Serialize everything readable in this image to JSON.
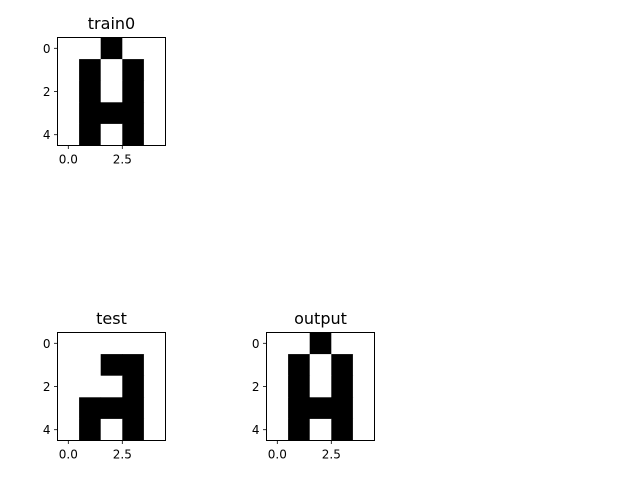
{
  "chart_data": [
    {
      "type": "heatmap",
      "title": "train0",
      "grid": [
        [
          0,
          0,
          1,
          0,
          0
        ],
        [
          0,
          1,
          0,
          1,
          0
        ],
        [
          0,
          1,
          0,
          1,
          0
        ],
        [
          0,
          1,
          1,
          1,
          0
        ],
        [
          0,
          1,
          0,
          1,
          0
        ]
      ],
      "xticks": [
        0.0,
        2.5
      ],
      "xtick_labels": [
        "0.0",
        "2.5"
      ],
      "yticks": [
        0,
        2,
        4
      ],
      "ytick_labels": [
        "0",
        "2",
        "4"
      ],
      "colors": {
        "0": "#ffffff",
        "1": "#000000"
      }
    },
    {
      "type": "heatmap",
      "title": "test",
      "grid": [
        [
          0,
          0,
          0,
          0,
          0
        ],
        [
          0,
          0,
          1,
          1,
          0
        ],
        [
          0,
          0,
          0,
          1,
          0
        ],
        [
          0,
          1,
          1,
          1,
          0
        ],
        [
          0,
          1,
          0,
          1,
          0
        ]
      ],
      "xticks": [
        0.0,
        2.5
      ],
      "xtick_labels": [
        "0.0",
        "2.5"
      ],
      "yticks": [
        0,
        2,
        4
      ],
      "ytick_labels": [
        "0",
        "2",
        "4"
      ],
      "colors": {
        "0": "#ffffff",
        "1": "#000000"
      }
    },
    {
      "type": "heatmap",
      "title": "output",
      "grid": [
        [
          0,
          0,
          1,
          0,
          0
        ],
        [
          0,
          1,
          0,
          1,
          0
        ],
        [
          0,
          1,
          0,
          1,
          0
        ],
        [
          0,
          1,
          1,
          1,
          0
        ],
        [
          0,
          1,
          0,
          1,
          0
        ]
      ],
      "xticks": [
        0.0,
        2.5
      ],
      "xtick_labels": [
        "0.0",
        "2.5"
      ],
      "yticks": [
        0,
        2,
        4
      ],
      "ytick_labels": [
        "0",
        "2",
        "4"
      ],
      "colors": {
        "0": "#ffffff",
        "1": "#000000"
      }
    }
  ]
}
